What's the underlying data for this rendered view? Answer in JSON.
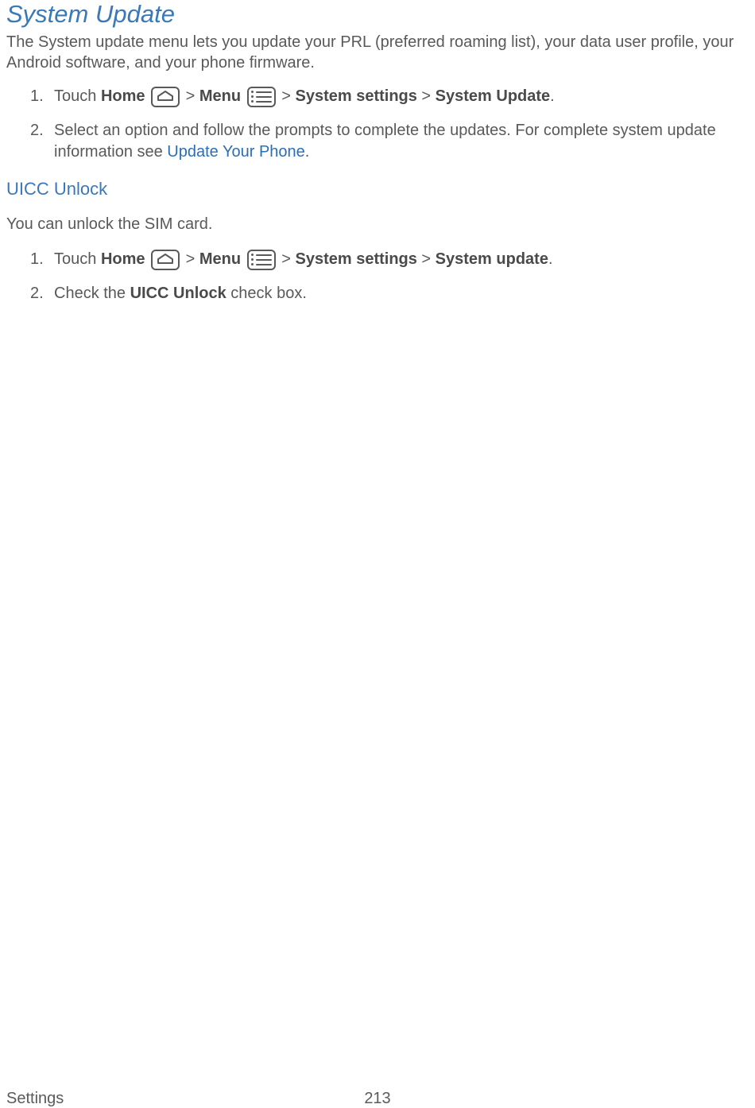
{
  "heading1": "System Update",
  "intro": "The System update menu lets you update your PRL (preferred roaming list), your data user profile, your Android software, and your phone firmware.",
  "list1": {
    "item1": {
      "num": "1.",
      "prefix": "Touch ",
      "home": "Home",
      "gt1": " > ",
      "menu": "Menu",
      "gt2": " > ",
      "syssettings": "System settings",
      "gt3": " > ",
      "sysupdate": "System Update",
      "period": "."
    },
    "item2": {
      "num": "2.",
      "text1": "Select an option and follow the prompts to complete the updates. For complete system update information see ",
      "link": "Update Your Phone",
      "text2": "."
    }
  },
  "heading3": "UICC Unlock",
  "para2": "You can unlock the SIM card.",
  "list2": {
    "item1": {
      "num": "1.",
      "prefix": "Touch ",
      "home": "Home",
      "gt1": " > ",
      "menu": "Menu",
      "gt2": " > ",
      "syssettings": "System settings",
      "gt3": " > ",
      "sysupdate": "System update",
      "period": "."
    },
    "item2": {
      "num": "2.",
      "text1": "Check the ",
      "bold": "UICC Unlock",
      "text2": " check box."
    }
  },
  "footer": {
    "left": "Settings",
    "center": "213"
  }
}
